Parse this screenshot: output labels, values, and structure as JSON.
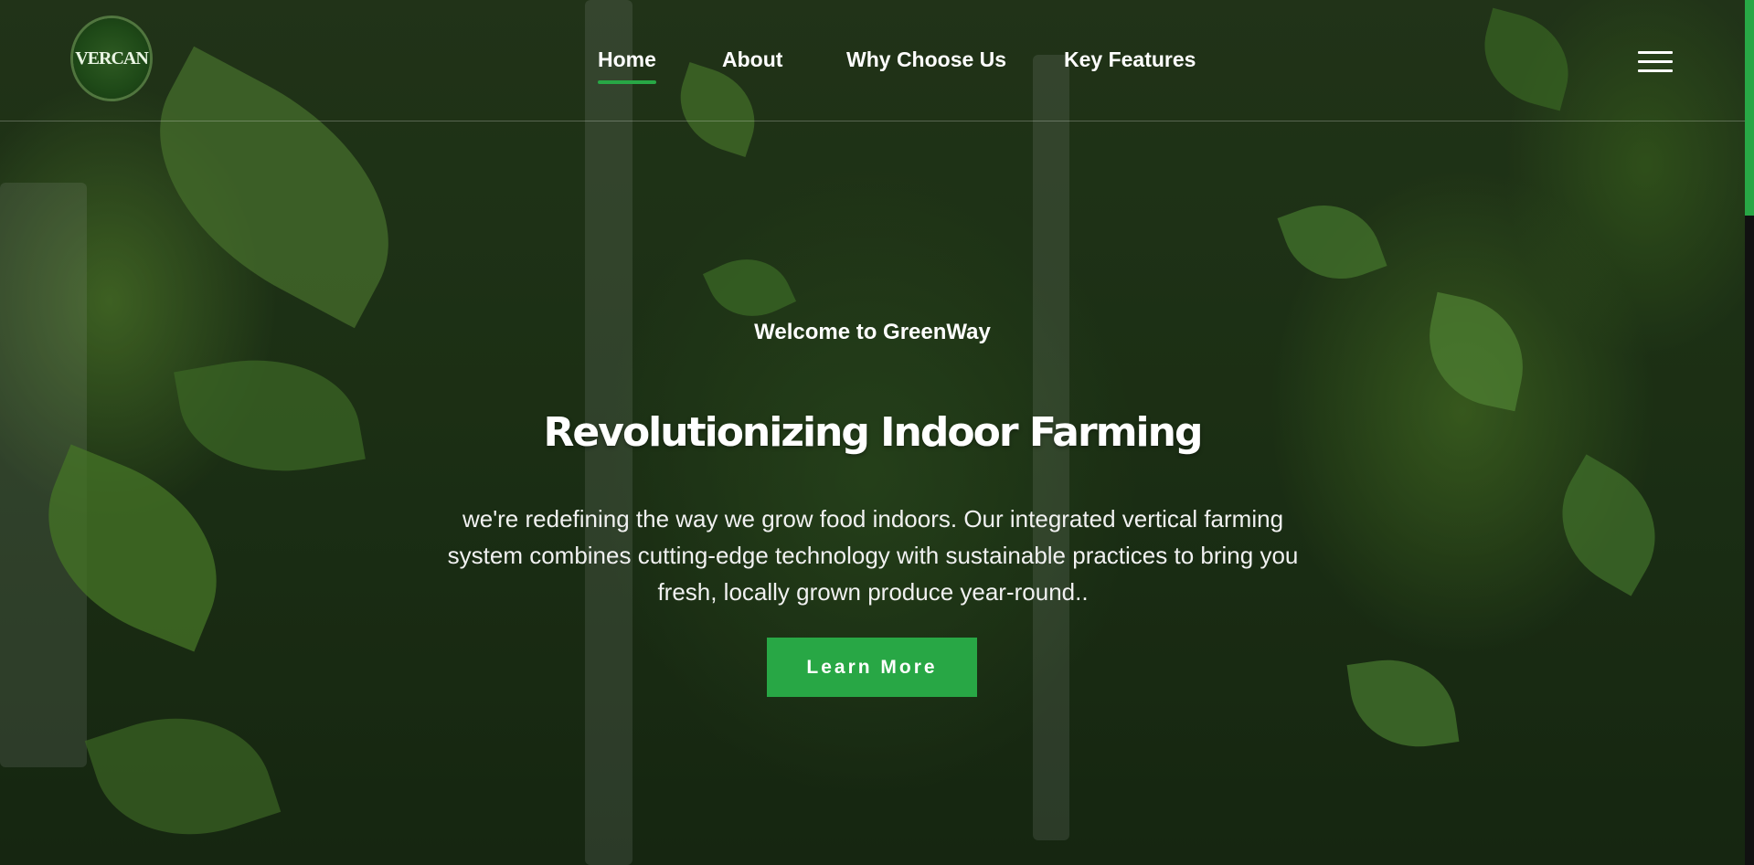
{
  "header": {
    "logo_text": "VERCAN",
    "nav": [
      {
        "label": "Home",
        "active": true
      },
      {
        "label": "About",
        "active": false
      },
      {
        "label": "Why Choose Us",
        "active": false
      },
      {
        "label": "Key Features",
        "active": false
      }
    ],
    "menu_icon": "hamburger-menu-icon"
  },
  "hero": {
    "welcome": "Welcome to GreenWay",
    "title": "Revolutionizing Indoor Farming",
    "description": "we're redefining the way we grow food indoors. Our integrated vertical farming system combines cutting-edge technology with sustainable practices to bring you fresh, locally grown produce year-round..",
    "cta_label": "Learn More"
  },
  "colors": {
    "accent": "#28a745",
    "background": "#243a1a"
  }
}
